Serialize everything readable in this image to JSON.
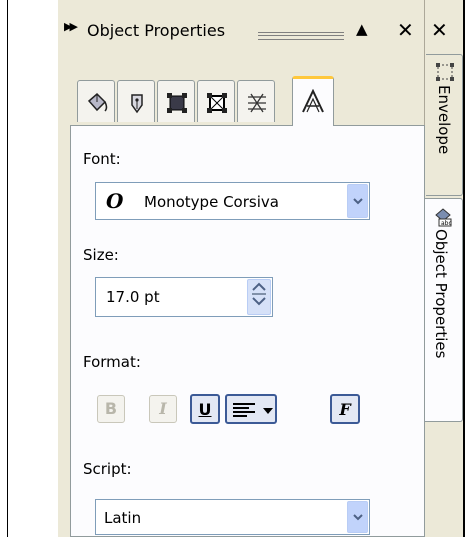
{
  "panel": {
    "title": "Object Properties",
    "expand_glyph": "▶▶",
    "minimize_glyph": "▲",
    "close_glyph": "✕",
    "close_outer_glyph": "✕"
  },
  "side_tabs": [
    "Envelope",
    "Object Properties"
  ],
  "tabs": [
    {
      "icon": "fill-bucket-icon",
      "active": false
    },
    {
      "icon": "pen-nib-icon",
      "active": false
    },
    {
      "icon": "frame-icon",
      "active": false
    },
    {
      "icon": "frame-cross-icon",
      "active": false
    },
    {
      "icon": "hatch-icon",
      "active": false
    },
    {
      "icon": "text-a-icon",
      "active": true
    }
  ],
  "font": {
    "label": "Font:",
    "value": "Monotype Corsiva",
    "icon_glyph": "O"
  },
  "size": {
    "label": "Size:",
    "value": "17.0 pt"
  },
  "format": {
    "label": "Format:",
    "buttons": [
      {
        "name": "bold",
        "glyph": "B",
        "state": "disabled"
      },
      {
        "name": "italic",
        "glyph": "I",
        "state": "disabled"
      },
      {
        "name": "underline",
        "glyph": "U",
        "state": "pressed"
      },
      {
        "name": "align",
        "glyph": "≡",
        "state": "pressed"
      },
      {
        "name": "character-format",
        "glyph": "F",
        "state": "pressed"
      }
    ]
  },
  "script": {
    "label": "Script:",
    "value": "Latin"
  },
  "colors": {
    "active_tab_border": "#ffc83c",
    "combo_button": "#c1d3fb",
    "panel_bg": "#ece9d8",
    "pressed_border": "#3c5a96"
  }
}
